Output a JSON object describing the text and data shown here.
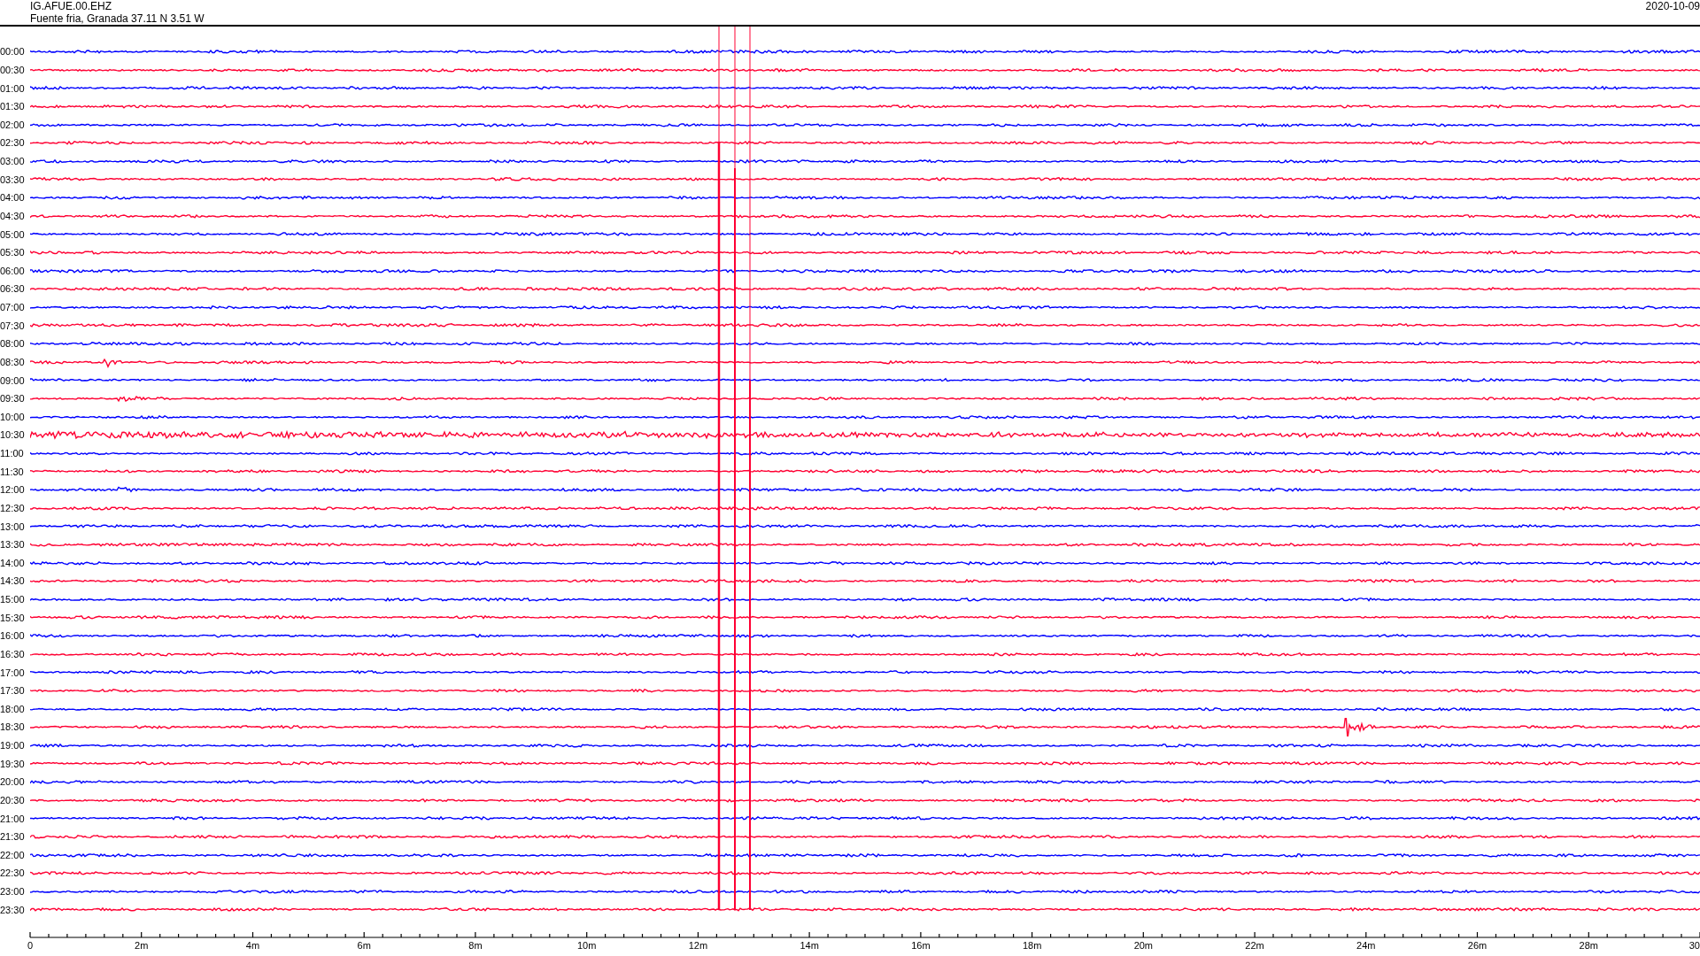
{
  "header": {
    "station": "IG.AFUE.00.EHZ",
    "location": "Fuente fria, Granada  37.11 N 3.51 W",
    "date": "2020-10-09"
  },
  "rows": [
    {
      "label": "00:00",
      "color": "#0000ff"
    },
    {
      "label": "00:30",
      "color": "#ff0033"
    },
    {
      "label": "01:00",
      "color": "#0000ff"
    },
    {
      "label": "01:30",
      "color": "#ff0033"
    },
    {
      "label": "02:00",
      "color": "#0000ff"
    },
    {
      "label": "02:30",
      "color": "#ff0033"
    },
    {
      "label": "03:00",
      "color": "#0000ff"
    },
    {
      "label": "03:30",
      "color": "#ff0033"
    },
    {
      "label": "04:00",
      "color": "#0000ff"
    },
    {
      "label": "04:30",
      "color": "#ff0033"
    },
    {
      "label": "05:00",
      "color": "#0000ff"
    },
    {
      "label": "05:30",
      "color": "#ff0033"
    },
    {
      "label": "06:00",
      "color": "#0000ff"
    },
    {
      "label": "06:30",
      "color": "#ff0033"
    },
    {
      "label": "07:00",
      "color": "#0000ff"
    },
    {
      "label": "07:30",
      "color": "#ff0033"
    },
    {
      "label": "08:00",
      "color": "#0000ff"
    },
    {
      "label": "08:30",
      "color": "#ff0033"
    },
    {
      "label": "09:00",
      "color": "#0000ff"
    },
    {
      "label": "09:30",
      "color": "#ff0033"
    },
    {
      "label": "10:00",
      "color": "#0000ff"
    },
    {
      "label": "10:30",
      "color": "#ff0033"
    },
    {
      "label": "11:00",
      "color": "#0000ff"
    },
    {
      "label": "11:30",
      "color": "#ff0033"
    },
    {
      "label": "12:00",
      "color": "#0000ff"
    },
    {
      "label": "12:30",
      "color": "#ff0033"
    },
    {
      "label": "13:00",
      "color": "#0000ff"
    },
    {
      "label": "13:30",
      "color": "#ff0033"
    },
    {
      "label": "14:00",
      "color": "#0000ff"
    },
    {
      "label": "14:30",
      "color": "#ff0033"
    },
    {
      "label": "15:00",
      "color": "#0000ff"
    },
    {
      "label": "15:30",
      "color": "#ff0033"
    },
    {
      "label": "16:00",
      "color": "#0000ff"
    },
    {
      "label": "16:30",
      "color": "#ff0033"
    },
    {
      "label": "17:00",
      "color": "#0000ff"
    },
    {
      "label": "17:30",
      "color": "#ff0033"
    },
    {
      "label": "18:00",
      "color": "#0000ff"
    },
    {
      "label": "18:30",
      "color": "#ff0033"
    },
    {
      "label": "19:00",
      "color": "#0000ff"
    },
    {
      "label": "19:30",
      "color": "#ff0033"
    },
    {
      "label": "20:00",
      "color": "#0000ff"
    },
    {
      "label": "20:30",
      "color": "#ff0033"
    },
    {
      "label": "21:00",
      "color": "#0000ff"
    },
    {
      "label": "21:30",
      "color": "#ff0033"
    },
    {
      "label": "22:00",
      "color": "#0000ff"
    },
    {
      "label": "22:30",
      "color": "#ff0033"
    },
    {
      "label": "23:00",
      "color": "#0000ff"
    },
    {
      "label": "23:30",
      "color": "#ff0033"
    }
  ],
  "x_axis": {
    "ticks": [
      "0",
      "2m",
      "4m",
      "6m",
      "8m",
      "10m",
      "12m",
      "14m",
      "16m",
      "18m",
      "20m",
      "22m",
      "24m",
      "26m",
      "28m",
      "30"
    ]
  }
}
